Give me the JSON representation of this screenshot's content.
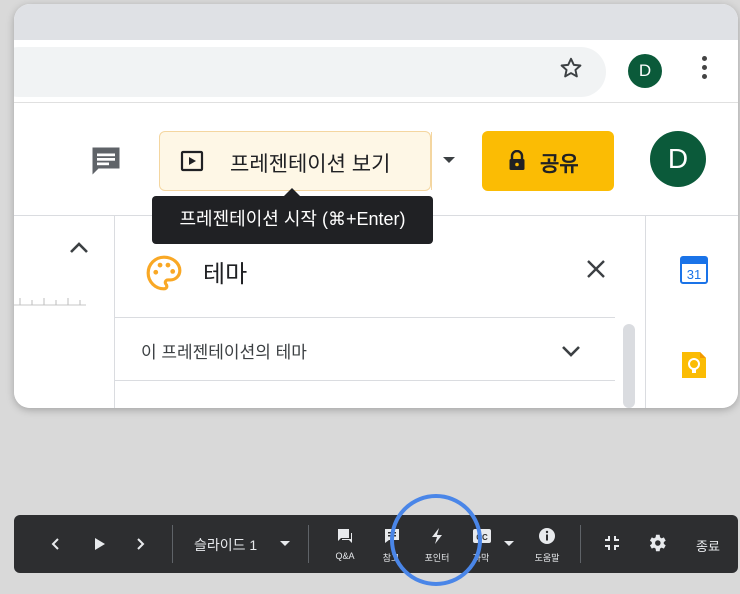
{
  "browser": {
    "profile_initial": "D"
  },
  "appbar": {
    "present_label": "프레젠테이션 보기",
    "share_label": "공유",
    "account_initial": "D"
  },
  "tooltip": {
    "text": "프레젠테이션 시작 (⌘+Enter)"
  },
  "theme_panel": {
    "title": "테마",
    "section_label": "이 프레젠테이션의 테마"
  },
  "side_apps": {
    "calendar_day": "31"
  },
  "presenter_bar": {
    "slide_label": "슬라이드 1",
    "qa_label": "Q&A",
    "notes_label": "참고",
    "pointer_label": "포인터",
    "captions_label": "자막",
    "help_label": "도움말",
    "end_label": "종료"
  },
  "colors": {
    "share_button": "#fbbc04",
    "avatar": "#0b5a3a",
    "highlight_ring": "#4a86e8",
    "presenter_bar": "#2d2e30"
  }
}
